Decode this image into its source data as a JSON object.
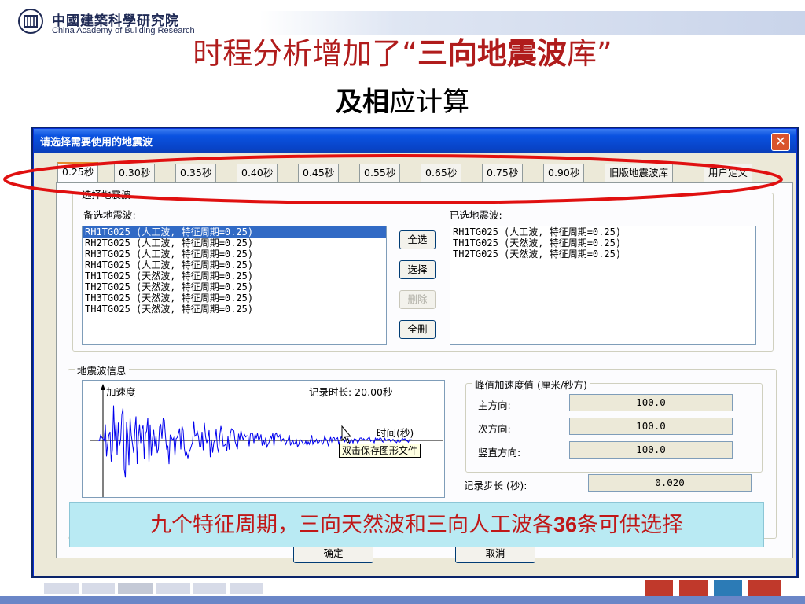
{
  "slide": {
    "logo_cn": "中國建築科學研究院",
    "logo_en": "China Academy of Building Research",
    "title_line1_pre": "时程分析增加了“",
    "title_line1_bold": "三向地震波",
    "title_line1_post": "库”",
    "title_line2_bold": "及相",
    "title_line2_rest": "应计算",
    "note_pre": "九个特征周期，三向天然波和三向人工波各",
    "note_num": "36",
    "note_post": "条可供选择"
  },
  "dialog": {
    "title": "请选择需要使用的地震波",
    "close_glyph": "✕",
    "tabs": [
      "0.25秒",
      "0.30秒",
      "0.35秒",
      "0.40秒",
      "0.45秒",
      "0.55秒",
      "0.65秒",
      "0.75秒",
      "0.90秒",
      "旧版地震波库",
      "用户定义"
    ],
    "active_tab": 0,
    "select_group": {
      "label": "选择地震波",
      "available_label": "备选地震波:",
      "selected_label": "已选地震波:",
      "available": [
        "RH1TG025 (人工波, 特征周期=0.25)",
        "RH2TG025 (人工波, 特征周期=0.25)",
        "RH3TG025 (人工波, 特征周期=0.25)",
        "RH4TG025 (人工波, 特征周期=0.25)",
        "TH1TG025 (天然波, 特征周期=0.25)",
        "TH2TG025 (天然波, 特征周期=0.25)",
        "TH3TG025 (天然波, 特征周期=0.25)",
        "TH4TG025 (天然波, 特征周期=0.25)"
      ],
      "available_selected_index": 0,
      "selected": [
        "RH1TG025 (人工波, 特征周期=0.25)",
        "TH1TG025 (天然波, 特征周期=0.25)",
        "TH2TG025 (天然波, 特征周期=0.25)"
      ],
      "buttons": {
        "select_all": "全选",
        "select": "选择",
        "delete": "删除",
        "delete_all": "全删"
      }
    },
    "info_group": {
      "label": "地震波信息",
      "y_axis": "加速度",
      "duration": "记录时长: 20.00秒",
      "x_axis": "时间(秒)",
      "tooltip": "双击保存图形文件",
      "peak_group_label": "峰值加速度值 (厘米/秒方)",
      "main_dir_label": "主方向:",
      "main_dir_value": "100.0",
      "sec_dir_label": "次方向:",
      "sec_dir_value": "100.0",
      "vert_dir_label": "竖直方向:",
      "vert_dir_value": "100.0",
      "step_label": "记录步长 (秒):",
      "step_value": "0.020"
    },
    "ok_button": "确定",
    "cancel_button": "取消"
  },
  "colors": {
    "title_red": "#b01c1c",
    "annotation_red": "#e01010",
    "note_bg": "#b9eaf3",
    "wave_blue": "#0000ee",
    "xp_blue": "#0a52e0"
  }
}
